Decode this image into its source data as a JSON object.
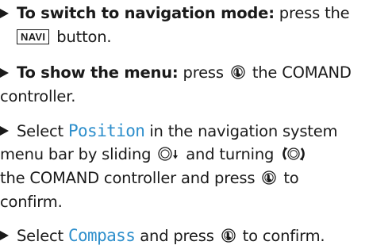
{
  "steps": [
    {
      "bold_prefix": "To switch to navigation mode:",
      "text_before_key": "press the",
      "key_label": "NAVI",
      "text_after_key": "button."
    },
    {
      "bold_prefix": "To show the menu:",
      "text_before_icon": "press",
      "icon": "press-controller-icon",
      "text_after_icon": "the COMAND",
      "line2": "controller."
    },
    {
      "text_select": "Select",
      "menu_item": "Position",
      "text_after_item": "in the navigation system",
      "line2_text": "menu bar by sliding",
      "slide_icon": "slide-down-controller-icon",
      "line2_mid": "and turning",
      "turn_icon": "turn-controller-icon",
      "line3_text_before_icon": "the COMAND controller and press",
      "press_icon": "press-controller-icon",
      "line3_text_after_icon": "to",
      "line4": "confirm."
    },
    {
      "text_select": "Select",
      "menu_item": "Compass",
      "text_mid": "and press",
      "press_icon": "press-controller-icon",
      "text_end": "to confirm."
    }
  ],
  "colors": {
    "menu_item": "#2e8fcc",
    "text": "#1a1a1a"
  }
}
